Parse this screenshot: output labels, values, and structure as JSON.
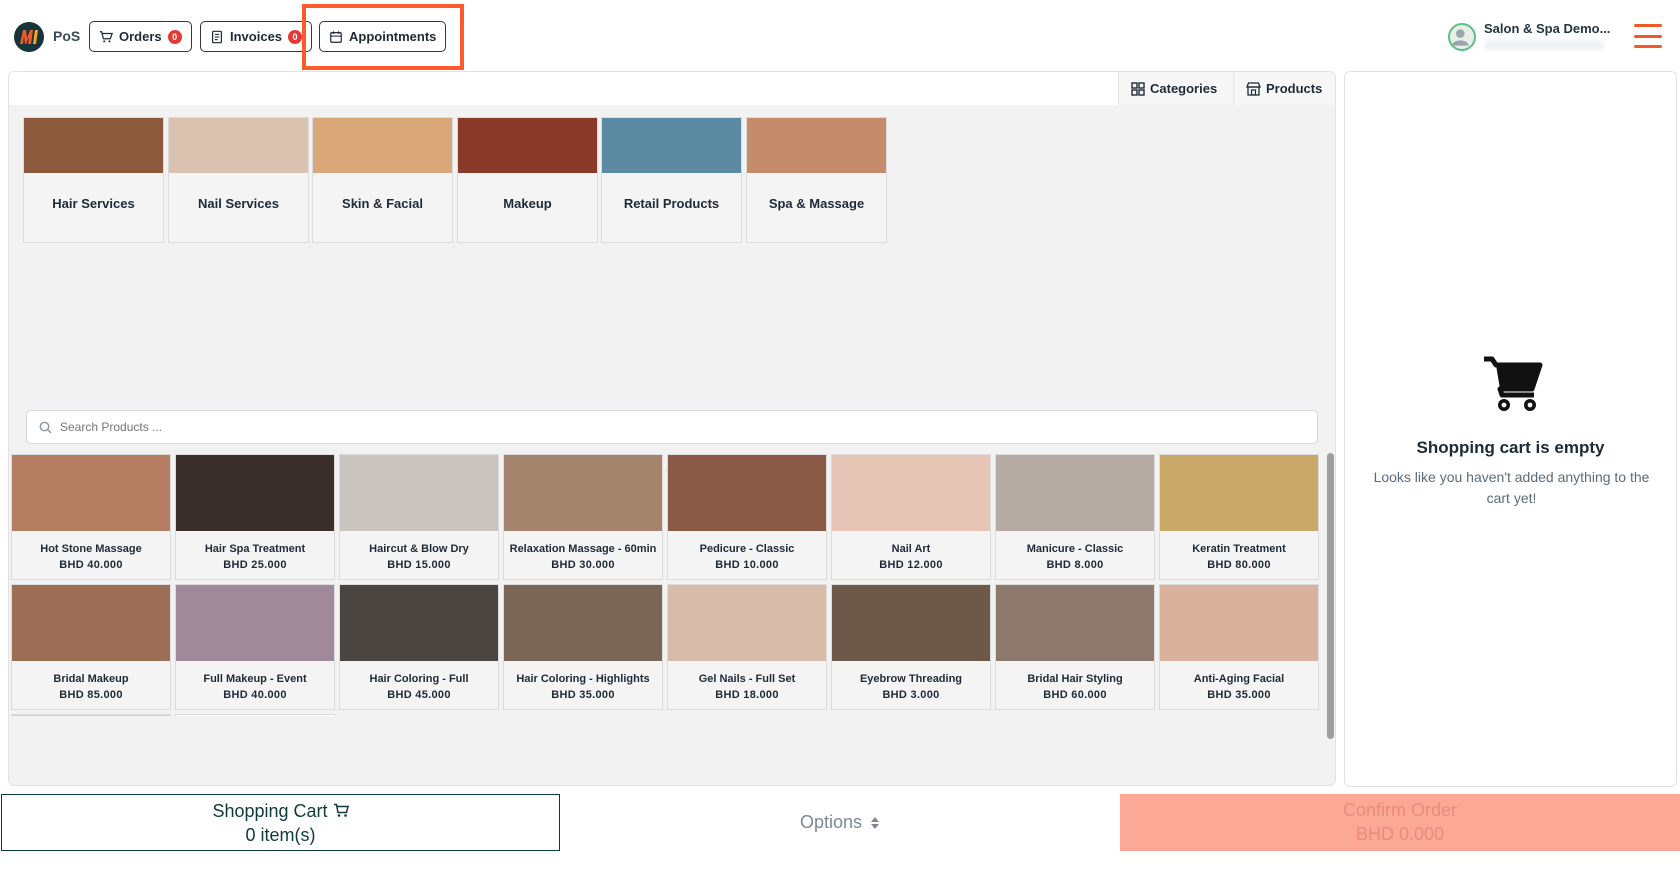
{
  "header": {
    "pos_label": "PoS",
    "orders_label": "Orders",
    "orders_count": "0",
    "invoices_label": "Invoices",
    "invoices_count": "0",
    "appointments_label": "Appointments",
    "user_name": "Salon & Spa Demo...",
    "accent": "#f05a28"
  },
  "tabs": {
    "categories_label": "Categories",
    "products_label": "Products"
  },
  "categories": [
    {
      "label": "Hair Services",
      "color": "#8b5a3c"
    },
    {
      "label": "Nail Services",
      "color": "#d9c2b0"
    },
    {
      "label": "Skin & Facial",
      "color": "#d9a77a"
    },
    {
      "label": "Makeup",
      "color": "#8a3a2a"
    },
    {
      "label": "Retail Products",
      "color": "#5c8aa3"
    },
    {
      "label": "Spa & Massage",
      "color": "#c48c6a"
    }
  ],
  "search": {
    "placeholder": "Search Products ..."
  },
  "products": [
    {
      "name": "Hot Stone Massage",
      "price": "BHD 40.000",
      "color": "#b57e62"
    },
    {
      "name": "Hair Spa Treatment",
      "price": "BHD 25.000",
      "color": "#3a2f2a"
    },
    {
      "name": "Haircut & Blow Dry",
      "price": "BHD 15.000",
      "color": "#c9c4be"
    },
    {
      "name": "Relaxation Massage - 60min",
      "price": "BHD 30.000",
      "color": "#a5846d"
    },
    {
      "name": "Pedicure - Classic",
      "price": "BHD 10.000",
      "color": "#8a5a46"
    },
    {
      "name": "Nail Art",
      "price": "BHD 12.000",
      "color": "#e6c4b6"
    },
    {
      "name": "Manicure - Classic",
      "price": "BHD 8.000",
      "color": "#b5aaa4"
    },
    {
      "name": "Keratin Treatment",
      "price": "BHD 80.000",
      "color": "#c9a868"
    },
    {
      "name": "Bridal Makeup",
      "price": "BHD 85.000",
      "color": "#9c6e55"
    },
    {
      "name": "Full Makeup - Event",
      "price": "BHD 40.000",
      "color": "#a08a9a"
    },
    {
      "name": "Hair Coloring - Full",
      "price": "BHD 45.000",
      "color": "#4a4540"
    },
    {
      "name": "Hair Coloring - Highlights",
      "price": "BHD 35.000",
      "color": "#7a6656"
    },
    {
      "name": "Gel Nails - Full Set",
      "price": "BHD 18.000",
      "color": "#d8bcaa"
    },
    {
      "name": "Eyebrow Threading",
      "price": "BHD 3.000",
      "color": "#6e584a"
    },
    {
      "name": "Bridal Hair Styling",
      "price": "BHD 60.000",
      "color": "#8d7a6c"
    },
    {
      "name": "Anti-Aging Facial",
      "price": "BHD 35.000",
      "color": "#d9b29e"
    },
    {
      "name": "",
      "price": "",
      "color": "#e0ccc0"
    },
    {
      "name": "",
      "price": "",
      "color": "#ffffff"
    }
  ],
  "cart": {
    "empty_title": "Shopping cart is empty",
    "empty_text": "Looks like you haven't added anything to the cart yet!"
  },
  "footer": {
    "cart_label": "Shopping Cart",
    "cart_items": "0 item(s)",
    "options_label": "Options",
    "confirm_label": "Confirm Order",
    "confirm_total": "BHD 0.000"
  }
}
